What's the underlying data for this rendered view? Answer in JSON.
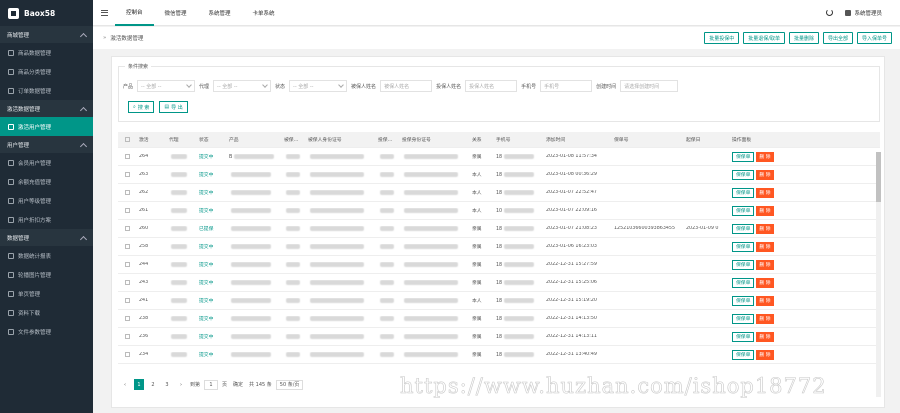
{
  "app": {
    "logo_text": "Baox58"
  },
  "sidebar": {
    "groups": [
      {
        "label": "商城管理",
        "items": [
          {
            "label": "商品数据管理",
            "icon": "home-icon"
          },
          {
            "label": "商品分类管理",
            "icon": "grid-icon"
          },
          {
            "label": "订单数据管理",
            "icon": "list-icon"
          }
        ]
      },
      {
        "label": "激活数据管理",
        "items": [
          {
            "label": "激活用户管理",
            "icon": "user-icon",
            "active": true
          }
        ]
      },
      {
        "label": "用户管理",
        "items": [
          {
            "label": "会员用户管理",
            "icon": "user-icon"
          },
          {
            "label": "余额充值管理",
            "icon": "coin-icon"
          },
          {
            "label": "用户等级管理",
            "icon": "level-icon"
          },
          {
            "label": "用户折扣方案",
            "icon": "discount-icon"
          }
        ]
      },
      {
        "label": "数据管理",
        "items": [
          {
            "label": "数据统计报表",
            "icon": "chart-icon"
          },
          {
            "label": "轮播图片管理",
            "icon": "image-icon"
          },
          {
            "label": "单页管理",
            "icon": "page-icon"
          },
          {
            "label": "资料下载",
            "icon": "download-icon"
          },
          {
            "label": "文件参数管理",
            "icon": "file-icon"
          }
        ]
      }
    ]
  },
  "topbar": {
    "tabs": [
      "控制台",
      "微信管理",
      "系统管理",
      "卡单系统"
    ],
    "active_tab": 0,
    "user": "系统管理员"
  },
  "breadcrumb": "激活数据管理",
  "top_buttons": [
    "批量投保中",
    "批量退保/取单",
    "批量删除",
    "导出全部",
    "导入保单号"
  ],
  "filter": {
    "legend": "条件搜索",
    "fields": [
      {
        "label": "产品",
        "type": "select",
        "value": "-- 全部 --"
      },
      {
        "label": "代理",
        "type": "select",
        "value": "-- 全部 --"
      },
      {
        "label": "状态",
        "type": "select",
        "value": "-- 全部 --"
      },
      {
        "label": "被保人姓名",
        "type": "input",
        "placeholder": "被保人姓名"
      },
      {
        "label": "投保人姓名",
        "type": "input",
        "placeholder": "投保人姓名"
      },
      {
        "label": "手机号",
        "type": "input",
        "placeholder": "手机号"
      },
      {
        "label": "创建时间",
        "type": "input",
        "placeholder": "请选择创建时间"
      }
    ],
    "search_label": "搜 索",
    "export_label": "导 出"
  },
  "table": {
    "headers": [
      "激活",
      "代理",
      "状态",
      "产品",
      "被保…",
      "被保人身份证号",
      "投保…",
      "投保身份证号",
      "关系",
      "手机号",
      "添加时间",
      "保单号",
      "起保日",
      "操作面板"
    ],
    "rows": [
      {
        "id": "264",
        "status": "提交中",
        "name": "B",
        "relation": "亲属",
        "phone": "18",
        "time": "2023-01-08 11:57:34",
        "policy": "",
        "start": ""
      },
      {
        "id": "263",
        "status": "提交中",
        "name": "",
        "relation": "本人",
        "phone": "18",
        "time": "2023-01-08 00:36:29",
        "policy": "",
        "start": ""
      },
      {
        "id": "262",
        "status": "提交中",
        "name": "",
        "relation": "本人",
        "phone": "18",
        "time": "2023-01-07 22:52:47",
        "policy": "",
        "start": ""
      },
      {
        "id": "261",
        "status": "提交中",
        "name": "",
        "relation": "本人",
        "phone": "10",
        "time": "2023-01-07 22:09:16",
        "policy": "",
        "start": ""
      },
      {
        "id": "260",
        "status": "已提保",
        "name": "",
        "relation": "亲属",
        "phone": "18",
        "time": "2023-01-07 21:08:23",
        "policy": "12521036600393863455",
        "start": "2023-01-09 0"
      },
      {
        "id": "258",
        "status": "提交中",
        "name": "",
        "relation": "亲属",
        "phone": "18",
        "time": "2023-01-06 16:23:03",
        "policy": "",
        "start": ""
      },
      {
        "id": "244",
        "status": "提交中",
        "name": "",
        "relation": "亲属",
        "phone": "18",
        "time": "2022-12-31 15:27:59",
        "policy": "",
        "start": ""
      },
      {
        "id": "243",
        "status": "提交中",
        "name": "",
        "relation": "亲属",
        "phone": "18",
        "time": "2022-12-31 15:25:06",
        "policy": "",
        "start": ""
      },
      {
        "id": "241",
        "status": "提交中",
        "name": "",
        "relation": "本人",
        "phone": "18",
        "time": "2022-12-31 15:19:20",
        "policy": "",
        "start": ""
      },
      {
        "id": "238",
        "status": "提交中",
        "name": "",
        "relation": "亲属",
        "phone": "18",
        "time": "2022-12-31 14:13:50",
        "policy": "",
        "start": ""
      },
      {
        "id": "236",
        "status": "提交中",
        "name": "",
        "relation": "亲属",
        "phone": "18",
        "time": "2022-12-31 14:13:11",
        "policy": "",
        "start": ""
      },
      {
        "id": "234",
        "status": "提交中",
        "name": "",
        "relation": "亲属",
        "phone": "18",
        "time": "2022-12-31 13:40:49",
        "policy": "",
        "start": ""
      }
    ],
    "row_btn_edit": "保保单",
    "row_btn_delete": "删 除"
  },
  "pagination": {
    "pages": [
      "1",
      "2",
      "3"
    ],
    "current": "1",
    "goto_label": "到第",
    "goto_value": "1",
    "page_unit": "页",
    "confirm": "确定",
    "total": "共 145 条",
    "page_size": "50 条/页"
  },
  "watermark": "https://www.huzhan.com/ishop18772",
  "colors": {
    "primary": "#009688",
    "danger": "#ff5722",
    "sidebar": "#1f2b36"
  }
}
